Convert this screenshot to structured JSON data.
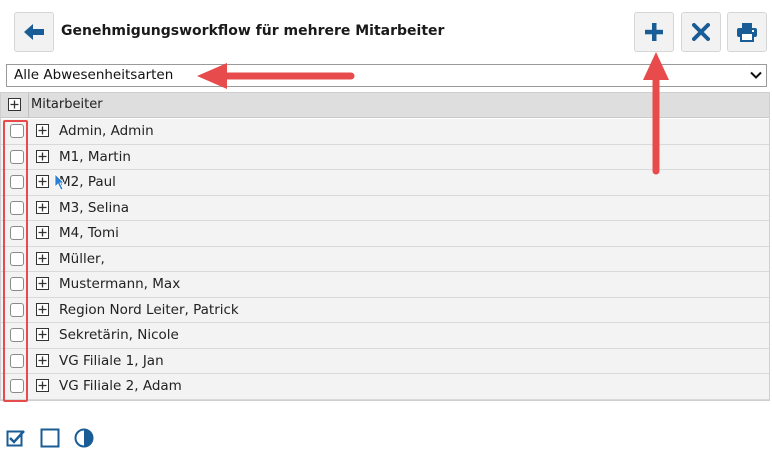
{
  "header": {
    "title": "Genehmigungsworkflow für mehrere Mitarbeiter",
    "icons": {
      "back": "arrow-left-icon",
      "add": "plus-icon",
      "close": "x-icon",
      "print": "printer-icon"
    }
  },
  "filter": {
    "selected": "Alle Abwesenheitsarten"
  },
  "grid": {
    "column_header": "Mitarbeiter",
    "rows": [
      "Admin, Admin",
      "M1, Martin",
      "M2, Paul",
      "M3, Selina",
      "M4, Tomi",
      "Müller,",
      "Mustermann, Max",
      "Region Nord Leiter, Patrick",
      "Sekretärin, Nicole",
      "VG Filiale 1, Jan",
      "VG Filiale 2, Adam"
    ]
  },
  "colors": {
    "accent": "#1a5d96",
    "annotation": "#e84b4b",
    "row_bg": "#f3f3f3",
    "header_bg": "#dedede"
  }
}
